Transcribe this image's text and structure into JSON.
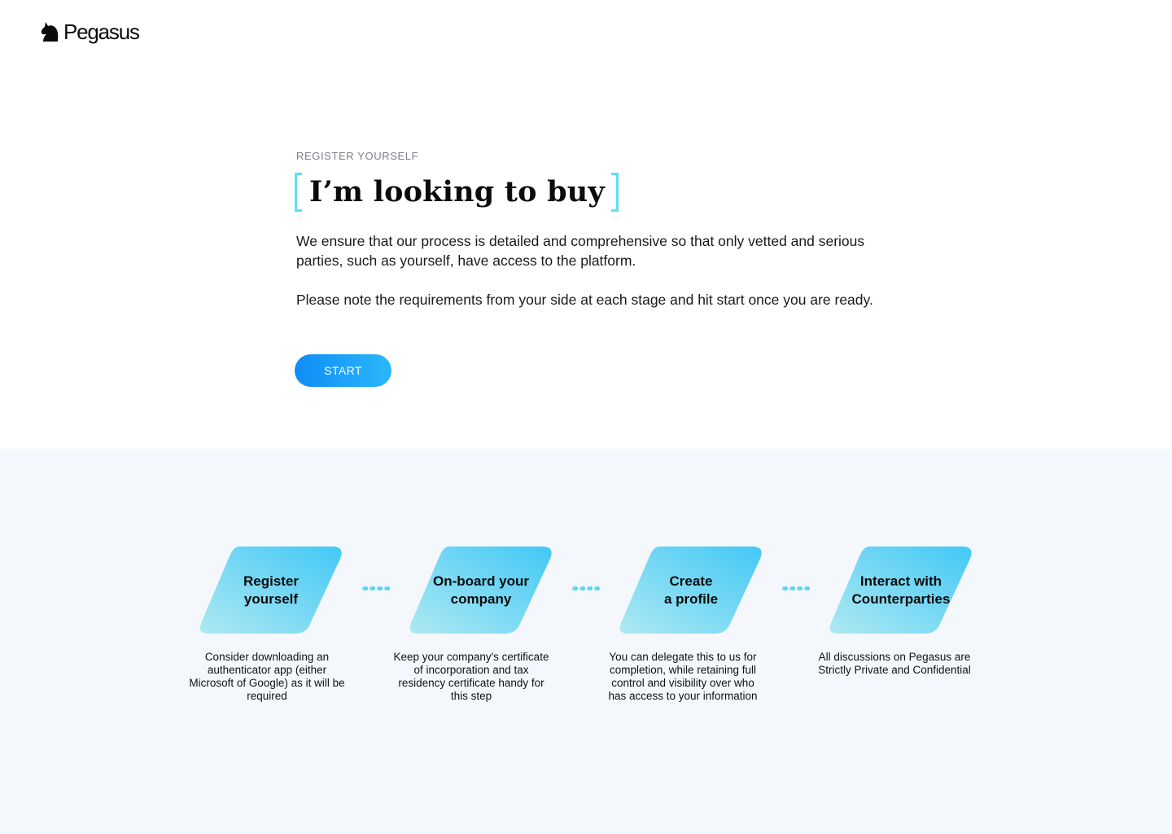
{
  "brand": {
    "name": "Pegasus"
  },
  "hero": {
    "eyebrow": "REGISTER YOURSELF",
    "title": "I’m looking to buy",
    "paragraph1": "We ensure that our process is detailed and comprehensive so that only vetted and serious parties, such as yourself, have access to the platform.",
    "paragraph2": "Please note the requirements from your side at each stage and hit start once you are ready.",
    "start_label": "START"
  },
  "steps": [
    {
      "title": "Register\nyourself",
      "description": "Consider downloading an authenticator app (either Microsoft of Google) as it will be required"
    },
    {
      "title": "On-board your\ncompany",
      "description": "Keep your company's certificate of incorporation and tax residency certificate handy for this step"
    },
    {
      "title": "Create\na profile",
      "description": "You can delegate this to us for completion, while retaining full control and visibility over who has access to your information"
    },
    {
      "title": "Interact with\nCounterparties",
      "description": "All discussions on Pegasus are Strictly Private and Confidential"
    }
  ],
  "colors": {
    "accent_bracket": "#5fe0ef",
    "button_start": "#0f8cf6",
    "button_end": "#2ab8fa",
    "band_background": "#f4f8fd"
  }
}
